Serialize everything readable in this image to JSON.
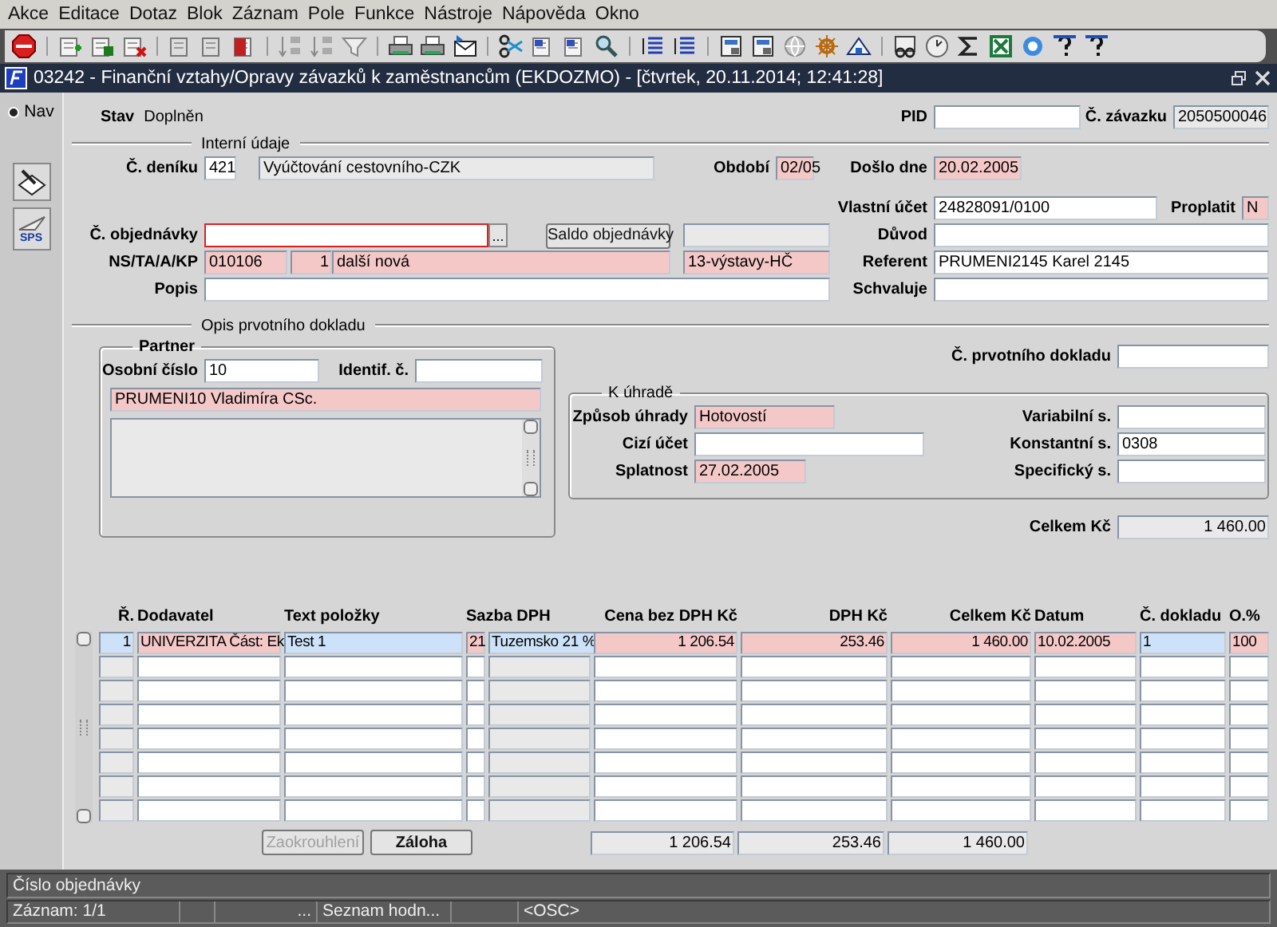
{
  "menu": [
    "Akce",
    "Editace",
    "Dotaz",
    "Blok",
    "Záznam",
    "Pole",
    "Funkce",
    "Nástroje",
    "Nápověda",
    "Okno"
  ],
  "window": {
    "title": "03242 - Finanční vztahy/Opravy závazků k zaměstnancům (EKDOZMO) - [čtvrtek, 20.11.2014; 12:41:28]"
  },
  "nav": {
    "label": "Nav",
    "selected": true,
    "tool_label": "SPS"
  },
  "header": {
    "stav_label": "Stav",
    "stav_value": "Doplněn",
    "pid": {
      "label": "PID",
      "kind": "edit"
    },
    "zavazek": {
      "label": "Č. závazku",
      "value": "2050500046",
      "kind": "readonly"
    }
  },
  "internal": {
    "title": "Interní údaje",
    "dennik": {
      "label": "Č. deníku",
      "value": "421",
      "kind": "edit"
    },
    "dennik_name": {
      "value": "Vyúčtování cestovního-CZK",
      "kind": "readonly"
    },
    "obdobi": {
      "label": "Období",
      "value": "02/05",
      "kind": "required"
    },
    "doslo": {
      "label": "Došlo dne",
      "value": "20.02.2005",
      "kind": "required"
    },
    "vlastni_ucet": {
      "label": "Vlastní účet",
      "value": "24828091/0100",
      "kind": "edit"
    },
    "proplatit": {
      "label": "Proplatit",
      "value": "N",
      "kind": "required"
    },
    "objednavka": {
      "label": "Č. objednávky",
      "kind": "focus"
    },
    "lov_button": "...",
    "saldo_button": "Saldo objednávky",
    "saldo_value": {
      "kind": "readonly"
    },
    "duvod": {
      "label": "Důvod",
      "kind": "edit"
    },
    "ns": {
      "label": "NS/TA/A/KP",
      "value": "010106",
      "kind": "required"
    },
    "ns_2": {
      "value": "1",
      "kind": "required"
    },
    "ns_3": {
      "value": "další nová",
      "kind": "required"
    },
    "ns_4": {
      "value": "13-výstavy-HČ",
      "kind": "required"
    },
    "referent": {
      "label": "Referent",
      "value": "PRUMENI2145 Karel 2145",
      "kind": "edit"
    },
    "popis": {
      "label": "Popis",
      "kind": "edit"
    },
    "schvaluje": {
      "label": "Schvaluje",
      "kind": "edit"
    }
  },
  "doc": {
    "title": "Opis prvotního dokladu",
    "partner": {
      "title": "Partner",
      "osobni": {
        "label": "Osobní číslo",
        "value": "10",
        "kind": "edit"
      },
      "identif": {
        "label": "Identif. č.",
        "kind": "edit"
      },
      "name": {
        "value": "PRUMENI10 Vladimíra CSc.",
        "kind": "required"
      },
      "note": {
        "kind": "readonly"
      }
    },
    "prvotni": {
      "label": "Č. prvotního dokladu",
      "kind": "edit"
    },
    "payment": {
      "title": "K úhradě",
      "zpusob": {
        "label": "Způsob úhrady",
        "value": "Hotovostí",
        "kind": "required"
      },
      "variabilni": {
        "label": "Variabilní s.",
        "kind": "edit"
      },
      "cizi": {
        "label": "Cizí účet",
        "kind": "edit"
      },
      "konstantni": {
        "label": "Konstantní s.",
        "value": "0308",
        "kind": "edit"
      },
      "splatnost": {
        "label": "Splatnost",
        "value": "27.02.2005",
        "kind": "required"
      },
      "specificky": {
        "label": "Specifický s.",
        "kind": "edit"
      }
    },
    "celkem": {
      "label": "Celkem Kč",
      "value": "1 460.00",
      "kind": "readonly"
    }
  },
  "table": {
    "columns": [
      "Ř.",
      "Dodavatel",
      "Text položky",
      "Sazba DPH",
      "Cena bez DPH Kč",
      "DPH Kč",
      "Celkem Kč",
      "Datum",
      "Č. dokladu",
      "O.%"
    ],
    "rows": [
      {
        "cells": [
          {
            "value": "1",
            "kind": "current"
          },
          {
            "value": "UNIVERZITA Část: Ek",
            "kind": "required"
          },
          {
            "value": "Test 1",
            "kind": "current"
          },
          {
            "value": "21",
            "kind": "required",
            "detail": {
              "value": "Tuzemsko 21 %",
              "kind": "current"
            }
          },
          {
            "value": "1 206.54",
            "kind": "required"
          },
          {
            "value": "253.46",
            "kind": "required"
          },
          {
            "value": "1 460.00",
            "kind": "required"
          },
          {
            "value": "10.02.2005",
            "kind": "required"
          },
          {
            "value": "1",
            "kind": "current"
          },
          {
            "value": "100",
            "kind": "required"
          }
        ]
      },
      {
        "cells": [
          {
            "kind": "readonly"
          },
          {
            "kind": "edit"
          },
          {
            "kind": "edit"
          },
          {
            "kind": "edit",
            "detail": {
              "kind": "readonly"
            }
          },
          {
            "kind": "edit"
          },
          {
            "kind": "edit"
          },
          {
            "kind": "edit"
          },
          {
            "kind": "edit"
          },
          {
            "kind": "edit"
          },
          {
            "kind": "edit"
          }
        ]
      },
      {
        "cells": [
          {
            "kind": "readonly"
          },
          {
            "kind": "edit"
          },
          {
            "kind": "edit"
          },
          {
            "kind": "edit",
            "detail": {
              "kind": "readonly"
            }
          },
          {
            "kind": "edit"
          },
          {
            "kind": "edit"
          },
          {
            "kind": "edit"
          },
          {
            "kind": "edit"
          },
          {
            "kind": "edit"
          },
          {
            "kind": "edit"
          }
        ]
      },
      {
        "cells": [
          {
            "kind": "readonly"
          },
          {
            "kind": "edit"
          },
          {
            "kind": "edit"
          },
          {
            "kind": "edit",
            "detail": {
              "kind": "readonly"
            }
          },
          {
            "kind": "edit"
          },
          {
            "kind": "edit"
          },
          {
            "kind": "edit"
          },
          {
            "kind": "edit"
          },
          {
            "kind": "edit"
          },
          {
            "kind": "edit"
          }
        ]
      },
      {
        "cells": [
          {
            "kind": "readonly"
          },
          {
            "kind": "edit"
          },
          {
            "kind": "edit"
          },
          {
            "kind": "edit",
            "detail": {
              "kind": "readonly"
            }
          },
          {
            "kind": "edit"
          },
          {
            "kind": "edit"
          },
          {
            "kind": "edit"
          },
          {
            "kind": "edit"
          },
          {
            "kind": "edit"
          },
          {
            "kind": "edit"
          }
        ]
      },
      {
        "cells": [
          {
            "kind": "readonly"
          },
          {
            "kind": "edit"
          },
          {
            "kind": "edit"
          },
          {
            "kind": "edit",
            "detail": {
              "kind": "readonly"
            }
          },
          {
            "kind": "edit"
          },
          {
            "kind": "edit"
          },
          {
            "kind": "edit"
          },
          {
            "kind": "edit"
          },
          {
            "kind": "edit"
          },
          {
            "kind": "edit"
          }
        ]
      },
      {
        "cells": [
          {
            "kind": "readonly"
          },
          {
            "kind": "edit"
          },
          {
            "kind": "edit"
          },
          {
            "kind": "edit",
            "detail": {
              "kind": "readonly"
            }
          },
          {
            "kind": "edit"
          },
          {
            "kind": "edit"
          },
          {
            "kind": "edit"
          },
          {
            "kind": "edit"
          },
          {
            "kind": "edit"
          },
          {
            "kind": "edit"
          }
        ]
      },
      {
        "cells": [
          {
            "kind": "readonly"
          },
          {
            "kind": "edit"
          },
          {
            "kind": "edit"
          },
          {
            "kind": "edit",
            "detail": {
              "kind": "readonly"
            }
          },
          {
            "kind": "edit"
          },
          {
            "kind": "edit"
          },
          {
            "kind": "edit"
          },
          {
            "kind": "edit"
          },
          {
            "kind": "edit"
          },
          {
            "kind": "edit"
          }
        ]
      }
    ]
  },
  "buttons": [
    {
      "label": "Zaokrouhlení",
      "disabled": true
    },
    {
      "label": "Záloha",
      "disabled": false
    }
  ],
  "totals": [
    {
      "value": "1 206.54",
      "kind": "readonly"
    },
    {
      "value": "253.46",
      "kind": "readonly"
    },
    {
      "value": "1 460.00",
      "kind": "readonly"
    }
  ],
  "status": {
    "message": "Číslo objednávky",
    "record": "Záznam: 1/1",
    "ellipsis": "...",
    "lov": "Seznam hodn...",
    "mode": "<OSC>"
  }
}
